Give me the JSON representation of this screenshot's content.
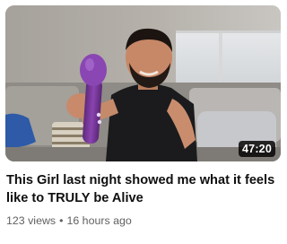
{
  "video": {
    "title": "This Girl last night showed me what it feels like to TRULY be Alive",
    "duration": "47:20",
    "views": "123 views",
    "separator": "•",
    "age": "16 hours ago"
  }
}
